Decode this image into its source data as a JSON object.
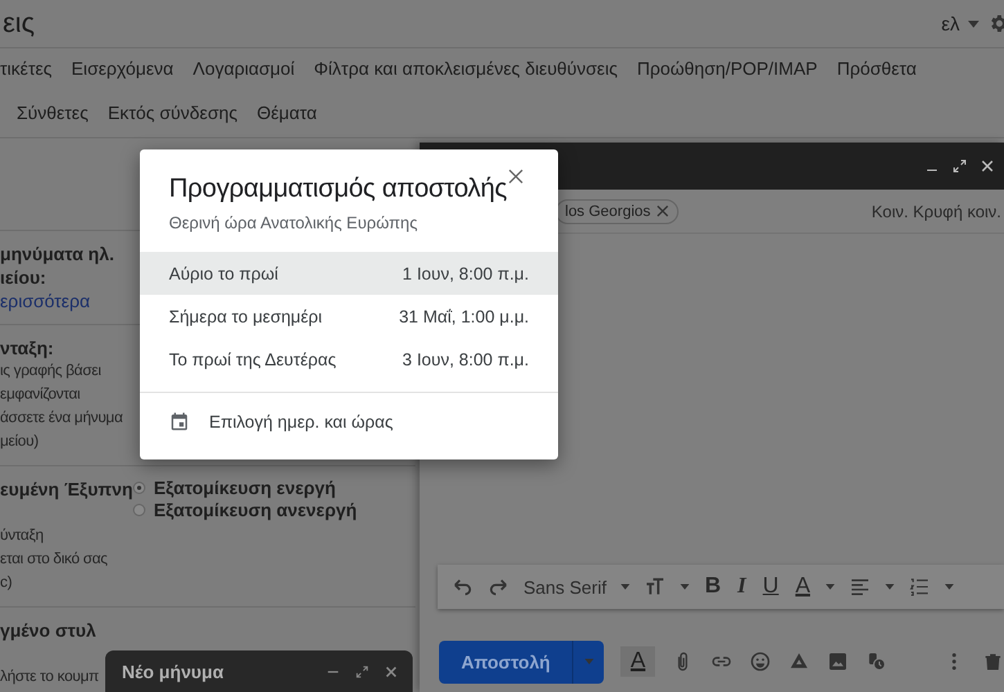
{
  "header": {
    "title": "εις",
    "language": "ελ"
  },
  "tabs_row_1": [
    {
      "label": "τικέτες",
      "selected": false
    },
    {
      "label": "Εισερχόμενα",
      "selected": false
    },
    {
      "label": "Λογαριασμοί",
      "selected": false
    },
    {
      "label": "Φίλτρα και αποκλεισμένες διευθύνσεις",
      "selected": false
    },
    {
      "label": "Προώθηση/POP/IMAP",
      "selected": false
    },
    {
      "label": "Πρόσθετα",
      "selected": false
    }
  ],
  "tabs_row_2": [
    {
      "label": "Σύνθετες",
      "selected": false
    },
    {
      "label": "Εκτός σύνδεσης",
      "selected": false
    },
    {
      "label": "Θέματα",
      "selected": false
    }
  ],
  "settings": [
    {
      "label_lines": [
        "μηνύματα ηλ.",
        "ιείου:"
      ],
      "link": "ερισσότερα"
    },
    {
      "label_lines": [
        "νταξη:"
      ],
      "description_lines": [
        "ις γραφής βάσει",
        "εμφανίζονται",
        "άσσετε ένα μήνυμα",
        "μείου)"
      ]
    },
    {
      "label_lines": [
        "ευμένη Έξυπνη"
      ],
      "description_lines": [
        "ύνταξη",
        "εται στο δικό σας",
        "c)"
      ],
      "options": [
        {
          "label": "Εξατομίκευση ενεργή",
          "selected": true
        },
        {
          "label": "Εξατομίκευση ανενεργή",
          "selected": false
        }
      ]
    },
    {
      "label_lines": [
        "γμένο στυλ"
      ],
      "description_lines": [
        "λήστε το κουμπ"
      ]
    }
  ],
  "compose": {
    "recipient": "los Georgios",
    "cc_bcc": "Κοιν. Κρυφή κοιν.",
    "font": "Sans Serif",
    "format_letters": [
      "B",
      "I",
      "U",
      "A"
    ],
    "send": "Αποστολή",
    "formatting_toggle": "A"
  },
  "mini_compose": {
    "title": "Νέο μήνυμα"
  },
  "dialog": {
    "title": "Προγραμματισμός αποστολής",
    "subtitle": "Θερινή ώρα Ανατολικής Ευρώπης",
    "options": [
      {
        "label": "Αύριο το πρωί",
        "time": "1 Ιουν, 8:00 π.μ.",
        "selected": true
      },
      {
        "label": "Σήμερα το μεσημέρι",
        "time": "31 Μαΐ, 1:00 μ.μ.",
        "selected": false
      },
      {
        "label": "Το πρωί της Δευτέρας",
        "time": "3 Ιουν, 8:00 π.μ.",
        "selected": false
      }
    ],
    "custom": "Επιλογή ημερ. και ώρας"
  }
}
